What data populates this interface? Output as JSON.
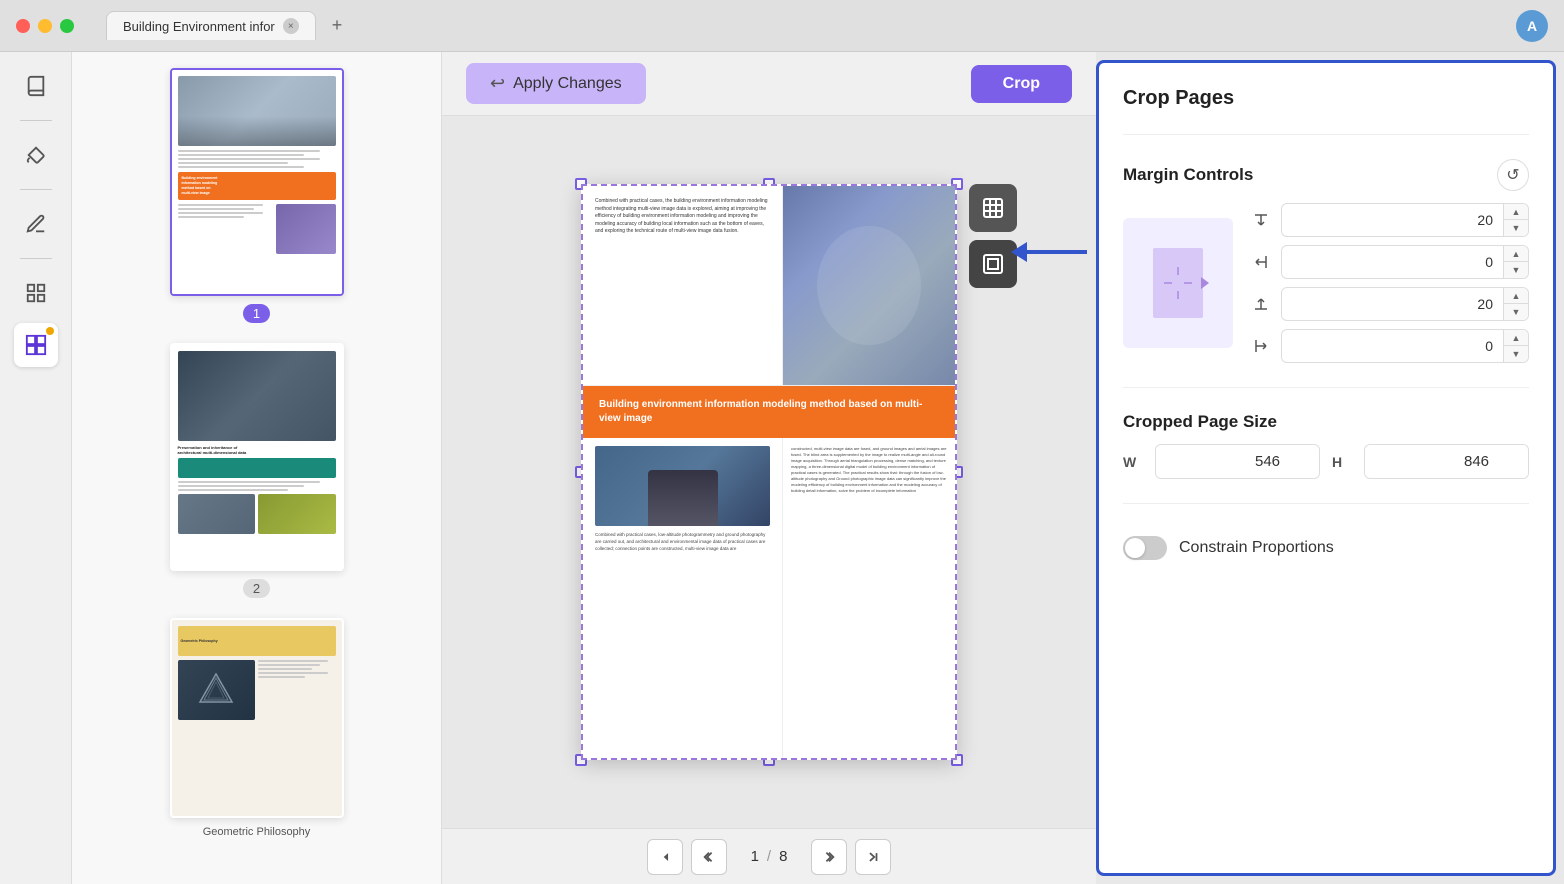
{
  "titlebar": {
    "tab_title": "Building Environment infor",
    "close_label": "×",
    "new_tab_label": "+",
    "avatar_letter": "A"
  },
  "sidebar": {
    "icons": [
      {
        "name": "book-icon",
        "symbol": "📖",
        "active": false
      },
      {
        "name": "divider1",
        "type": "divider"
      },
      {
        "name": "paint-icon",
        "symbol": "🖌️",
        "active": false
      },
      {
        "name": "divider2",
        "type": "divider"
      },
      {
        "name": "edit-icon",
        "symbol": "✏️",
        "active": false
      },
      {
        "name": "divider3",
        "type": "divider"
      },
      {
        "name": "pages-icon",
        "symbol": "📄",
        "active": false
      },
      {
        "name": "crop-pages-icon",
        "symbol": "⊞",
        "active": true,
        "has_dot": true
      }
    ]
  },
  "thumbnails": [
    {
      "page_num": "1",
      "selected": true,
      "label": "1"
    },
    {
      "page_num": "2",
      "selected": false,
      "label": "2"
    },
    {
      "page_num": "3",
      "selected": false,
      "label": "Geometric Philosophy"
    }
  ],
  "toolbar": {
    "apply_label": "Apply Changes",
    "crop_label": "Crop"
  },
  "page": {
    "left_text": "Combined with practical cases, the building environment information modeling method integrating multi-view image data is explored, aiming at improving the efficiency of building environment information modeling and improving the modeling accuracy of building local information such as the bottom of eaves, and exploring the technical route of multi-view image data fusion.",
    "orange_title": "Building environment information modeling method based on multi-view image",
    "bottom_left_text": "Combined with practical cases, low-altitude photogrammetry and ground photography are carried out, and architectural and environmental image data of practical cases are collected; connection points are constructed, multi-view image data are",
    "bottom_right_text": "constructed, multi-view image data are fused, and ground images and aerial images are fused. The blind area is supplemented by the image to realize multi-angle and all-round image acquisition. Through aerial triangulation processing, dense matching, and texture mapping, a three-dimensional digital model of building environment information of practical cases is generated. The practical results show that: through the fusion of low-altitude photography and Ground photographic image data can significantly improve the modeling efficiency of building environment information and the modeling accuracy of building detail information, solve the problem of incomplete information"
  },
  "crop_tools": [
    {
      "name": "fit-icon",
      "symbol": "⊠"
    },
    {
      "name": "crop-center-icon",
      "symbol": "⊡"
    }
  ],
  "pagination": {
    "first_label": "⟪",
    "prev_prev_label": "⟨⟨",
    "current_page": "1",
    "separator": "/",
    "total_pages": "8",
    "next_next_label": "⟩⟩",
    "last_label": "⟫",
    "first_sym": "⏮",
    "prev_sym": "⏪",
    "next_sym": "⏩",
    "last_sym": "⏭"
  },
  "right_panel": {
    "title": "Crop Pages",
    "margin_controls_title": "Margin Controls",
    "margin_top": "20",
    "margin_right": "0",
    "margin_bottom": "20",
    "margin_left": "0",
    "cropped_size_title": "Cropped Page Size",
    "width_label": "W",
    "height_label": "H",
    "width_value": "546",
    "height_value": "846",
    "constrain_title": "Constrain Proportions",
    "constrain_enabled": false
  }
}
